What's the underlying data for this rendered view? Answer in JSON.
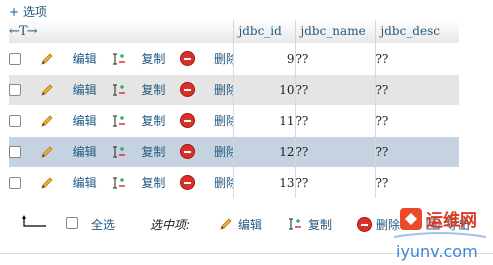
{
  "options_label": "+ 选项",
  "header": {
    "arrows": "←T→",
    "columns": [
      "jdbc_id",
      "jdbc_name",
      "jdbc_desc"
    ]
  },
  "actions": {
    "edit": "编辑",
    "copy": "复制",
    "delete": "删除"
  },
  "rows": [
    {
      "id": "9",
      "name": "??",
      "desc": "??"
    },
    {
      "id": "10",
      "name": "??",
      "desc": "??"
    },
    {
      "id": "11",
      "name": "??",
      "desc": "??"
    },
    {
      "id": "12",
      "name": "??",
      "desc": "??"
    },
    {
      "id": "13",
      "name": "??",
      "desc": "??"
    }
  ],
  "footer": {
    "select_all": "全选",
    "with_selected": "选中项:",
    "edit": "编辑",
    "copy": "复制",
    "delete": "删除",
    "export": "导出"
  },
  "watermark": {
    "brand": "运维网",
    "url": "iyunv.com"
  },
  "colors": {
    "link": "#235a81",
    "row_alt": "#e5e5e5",
    "row_marked": "#c5d3e1",
    "delete": "#d6322a"
  }
}
